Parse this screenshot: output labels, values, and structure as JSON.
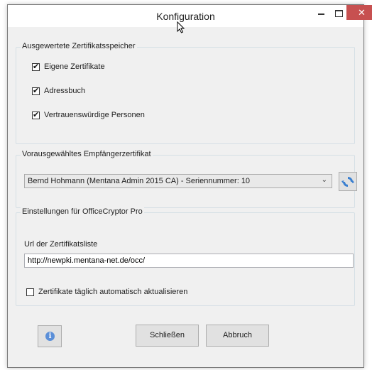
{
  "window": {
    "title": "Konfiguration",
    "minimize_icon": "minimize-icon",
    "maximize_icon": "maximize-icon",
    "close_icon": "close-icon",
    "close_color": "#c75050"
  },
  "stores": {
    "label": "Ausgewertete Zertifikatsspeicher",
    "items": [
      {
        "label": "Eigene Zertifikate",
        "checked": true
      },
      {
        "label": "Adressbuch",
        "checked": true
      },
      {
        "label": "Vertrauenswürdige Personen",
        "checked": true
      }
    ]
  },
  "recipient": {
    "label": "Vorausgewähltes Empfängerzertifikat",
    "selected": "Bernd Hohmann (Mentana Admin 2015 CA) - Seriennummer: 10",
    "refresh_icon": "refresh-icon"
  },
  "officecryptor": {
    "label": "Einstellungen für OfficeCryptor Pro",
    "url_label": "Url der Zertifikatsliste",
    "url_value": "http://newpki.mentana-net.de/occ/",
    "auto_update_label": "Zertifikate täglich automatisch aktualisieren",
    "auto_update_checked": false
  },
  "footer": {
    "info_icon": "info-icon",
    "close_label": "Schließen",
    "cancel_label": "Abbruch"
  }
}
